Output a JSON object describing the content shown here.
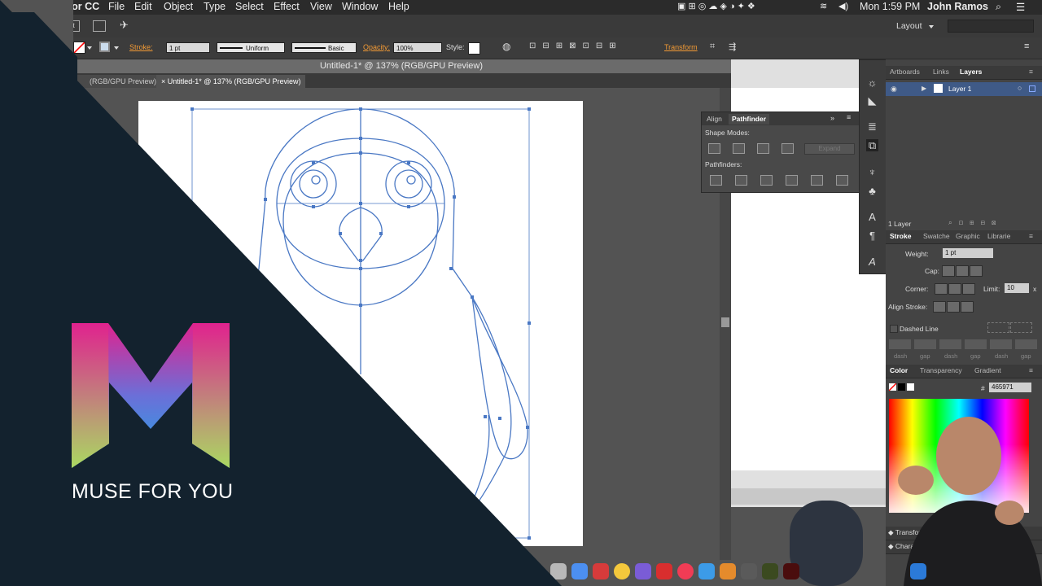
{
  "menubar": {
    "app": "Illustrator CC",
    "items": [
      "File",
      "Edit",
      "Object",
      "Type",
      "Select",
      "Effect",
      "View",
      "Window",
      "Help"
    ],
    "clock": "Mon 1:59 PM",
    "user": "John Ramos"
  },
  "appbar": {
    "workspace": "Layout",
    "sn": "St"
  },
  "control": {
    "stroke_label": "Stroke:",
    "stroke_value": "1 pt",
    "profile": "Uniform",
    "brush": "Basic",
    "opacity_label": "Opacity:",
    "opacity_value": "100%",
    "style_label": "Style:",
    "transform_label": "Transform"
  },
  "document": {
    "title": "Untitled-1* @ 137% (RGB/GPU Preview)",
    "tabs": [
      "(RGB/GPU Preview)",
      "Untitled-1* @ 137% (RGB/GPU Preview)"
    ]
  },
  "pathfinder": {
    "tabs": [
      "Align",
      "Pathfinder"
    ],
    "shape_modes": "Shape Modes:",
    "pathfinders": "Pathfinders:",
    "expand": "Expand"
  },
  "layers": {
    "tabs": [
      "Artboards",
      "Links",
      "Layers"
    ],
    "layer_name": "Layer 1",
    "count": "1 Layer"
  },
  "stroke_panel": {
    "tabs": [
      "Stroke",
      "Swatche",
      "Graphic",
      "Librarie"
    ],
    "weight_label": "Weight:",
    "weight_value": "1 pt",
    "cap_label": "Cap:",
    "corner_label": "Corner:",
    "limit_label": "Limit:",
    "limit_value": "10",
    "limit_unit": "x",
    "align_label": "Align Stroke:",
    "dashed_label": "Dashed Line",
    "dash_labels": [
      "dash",
      "gap",
      "dash",
      "gap",
      "dash",
      "gap"
    ]
  },
  "color_panel": {
    "tabs": [
      "Color",
      "Transparency",
      "Gradient"
    ],
    "hex_prefix": "#",
    "hex": "465971"
  },
  "collapsed": {
    "transform": "Transform",
    "character": "Character"
  },
  "brand": {
    "text": "MUSE FOR YOU"
  },
  "colors": {
    "path": "#4a78c4",
    "dark_overlay": "#13222e"
  }
}
